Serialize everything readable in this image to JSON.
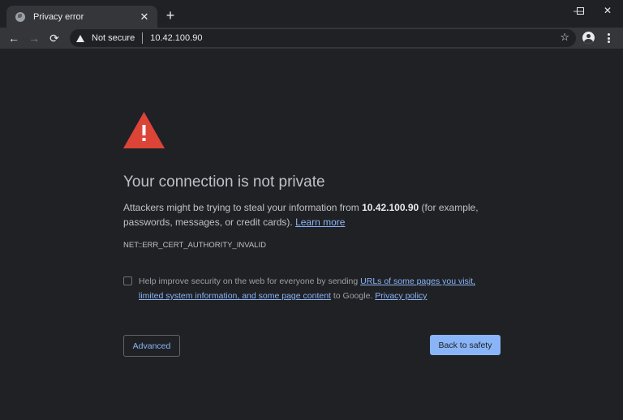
{
  "browser": {
    "tab": {
      "title": "Privacy error",
      "favicon": "globe-icon",
      "close_glyph": "✕"
    },
    "new_tab_glyph": "+",
    "window_controls": {
      "minimize": "—",
      "maximize": "☐",
      "close": "✕"
    },
    "nav": {
      "back": "←",
      "forward": "→",
      "reload": "⟳"
    },
    "omnibox": {
      "security_label": "Not secure",
      "url": "10.42.100.90",
      "star_glyph": "☆"
    }
  },
  "page": {
    "heading": "Your connection is not private",
    "message": {
      "before_host": "Attackers might be trying to steal your information from ",
      "host": "10.42.100.90",
      "after_host": " (for example, passwords, messages, or credit cards). ",
      "learn_more": "Learn more"
    },
    "error_code": "NET::ERR_CERT_AUTHORITY_INVALID",
    "optin": {
      "checked": false,
      "text_before": "Help improve security on the web for everyone by sending ",
      "link1": "URLs of some pages you visit, limited system information, and some page content",
      "text_middle": " to Google. ",
      "link2": "Privacy policy"
    },
    "buttons": {
      "advanced": "Advanced",
      "back_to_safety": "Back to safety"
    }
  },
  "colors": {
    "background": "#202124",
    "toolbar": "#35363a",
    "accent": "#8ab4f8",
    "warning": "#db4437"
  }
}
